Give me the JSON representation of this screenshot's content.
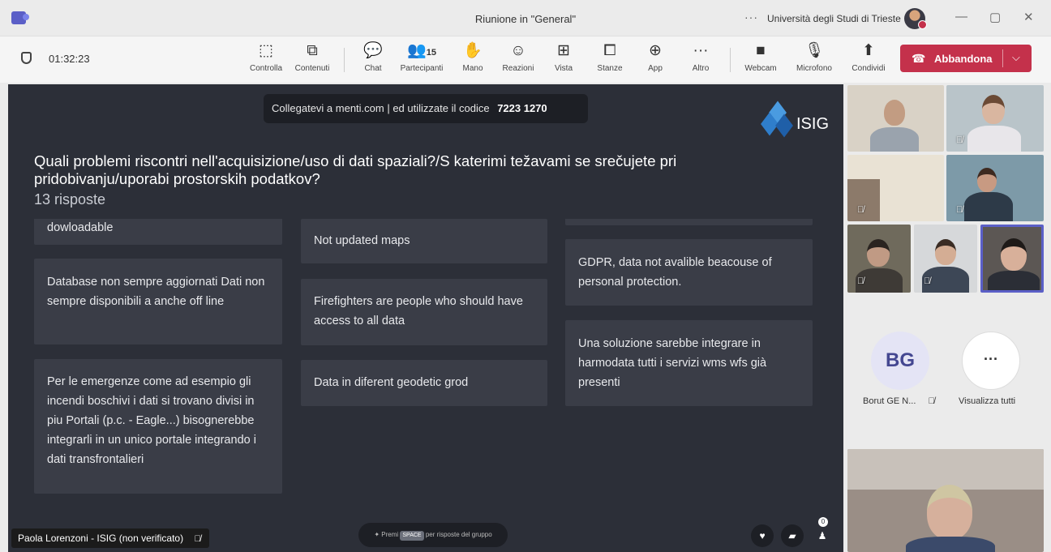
{
  "window": {
    "title": "Riunione in \"General\"",
    "organization": "Università degli Studi di Trieste",
    "more_icon": "more-icon",
    "controls": [
      "—",
      "▢",
      "✕"
    ]
  },
  "meeting": {
    "timer": "01:32:23",
    "tools": [
      {
        "id": "controlla",
        "label": "Controlla",
        "icon": "⬚"
      },
      {
        "id": "contenuti",
        "label": "Contenuti",
        "icon": "⧉"
      },
      {
        "id": "chat",
        "label": "Chat",
        "icon": "💬"
      },
      {
        "id": "partecipanti",
        "label": "Partecipanti",
        "icon": "👥",
        "count": "15"
      },
      {
        "id": "mano",
        "label": "Mano",
        "icon": "✋"
      },
      {
        "id": "reazioni",
        "label": "Reazioni",
        "icon": "☺"
      },
      {
        "id": "vista",
        "label": "Vista",
        "icon": "⊞"
      },
      {
        "id": "stanze",
        "label": "Stanze",
        "icon": "⧠"
      },
      {
        "id": "app",
        "label": "App",
        "icon": "⊕"
      },
      {
        "id": "altro",
        "label": "Altro",
        "icon": "···"
      },
      {
        "id": "webcam",
        "label": "Webcam",
        "icon": "■"
      },
      {
        "id": "microfono",
        "label": "Microfono",
        "icon": "🎙"
      },
      {
        "id": "condividi",
        "label": "Condividi",
        "icon": "⬆"
      }
    ],
    "leave_label": "Abbandona"
  },
  "presentation": {
    "join_text": "Collegatevi a menti.com | ed utilizzate il codice",
    "join_code": "7223 1270",
    "logo_text": "ISIG",
    "question": "Quali problemi riscontri nell'acquisizione/uso di dati spaziali?/S katerimi težavami se srečujete pri pridobivanju/uporabi prostorskih podatkov?",
    "responses_count": "13 risposte",
    "answers": [
      "dowloadable",
      "Database non sempre aggiornati Dati non sempre disponibili a anche off line",
      "Per le emergenze come ad esempio gli incendi boschivi i dati si trovano divisi in piu Portali (p.c. - Eagle...) bisognerebbe integrarli in un unico portale integrando i dati transfrontalieri",
      "Not updated maps",
      "Firefighters are people who should have access to all data",
      "Data in diferent geodetic grod",
      "GDPR, data not avalible beacouse of personal protection.",
      "Una soluzione sarebbe integrare in harmodata tutti i servizi wms wfs già presenti"
    ],
    "hint_prefix": "Premi",
    "hint_key": "SPACE",
    "hint_suffix": "per risposte del gruppo",
    "audience_count": "0",
    "speaker_name": "Paola Lorenzoni - ISIG (non verificato)"
  },
  "rail": {
    "initials": "BG",
    "participant_label": "Borut GE N...",
    "view_all_label": "Visualizza tutti",
    "view_all_icon": "···"
  }
}
